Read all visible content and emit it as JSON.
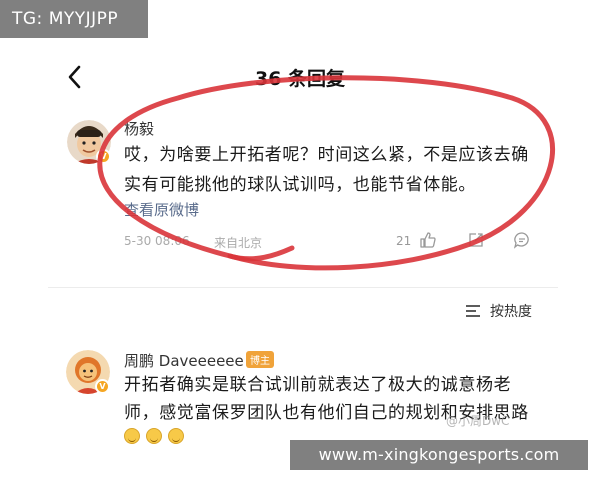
{
  "badges": {
    "tg": "TG: MYYJJPP"
  },
  "header": {
    "title": "36 条回复",
    "back_icon": "chevron-left-icon"
  },
  "comments": [
    {
      "author": "杨毅",
      "body_line1": "哎，为啥要上开拓者呢？时间这么紧，不是应该去确",
      "body_line2": "实有可能挑他的球队试训吗，也能节省体能。",
      "view_original": "查看原微博",
      "time": "5-30 08:06",
      "location": "来自北京",
      "likes": "21",
      "verified_icon": "verified-badge-icon"
    },
    {
      "author": "周鹏 Daveeeeee",
      "host_badge": "博主",
      "body_line1": "开拓者确实是联合试训前就表达了极大的诚意杨老",
      "body_line2": "师，感觉富保罗团队也有他们自己的规划和安排思路",
      "emoji_count": 3
    }
  ],
  "sort": {
    "label": "按热度",
    "icon": "sort-icon"
  },
  "watermarks": {
    "small": "@小周DwC",
    "site": "www.m-xingkongesports.com"
  },
  "colors": {
    "link": "#5a6c8c",
    "highlight_circle": "#d9343a",
    "host_badge": "#f0a33a"
  }
}
